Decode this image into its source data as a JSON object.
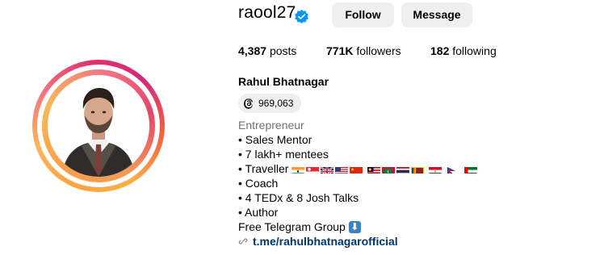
{
  "profile": {
    "username": "raool27",
    "verified": true,
    "follow_label": "Follow",
    "message_label": "Message",
    "full_name": "Rahul Bhatnagar"
  },
  "stats": {
    "posts_count": "4,387",
    "posts_label": "posts",
    "followers_count": "771K",
    "followers_label": "followers",
    "following_count": "182",
    "following_label": "following"
  },
  "threads": {
    "icon": "threads-icon",
    "count": "969,063"
  },
  "bio": {
    "category": "Entrepreneur",
    "lines": [
      "• Sales Mentor",
      "• 7 lakh+ mentees",
      "• Traveller",
      "• Coach",
      "• 4 TEDx & 8 Josh Talks",
      "• Author",
      "Free Telegram Group"
    ],
    "flags": [
      "india",
      "singapore",
      "uk",
      "usa",
      "china",
      "malaysia",
      "maldives",
      "thailand",
      "sri-lanka",
      "egypt",
      "nepal",
      "uae"
    ],
    "telegram_icon": "down-arrow-icon",
    "link": "t.me/rahulbhatnagarofficial"
  },
  "colors": {
    "button_bg": "#efefef",
    "link": "#00376b",
    "category": "#737373",
    "verified": "#0095f6"
  }
}
